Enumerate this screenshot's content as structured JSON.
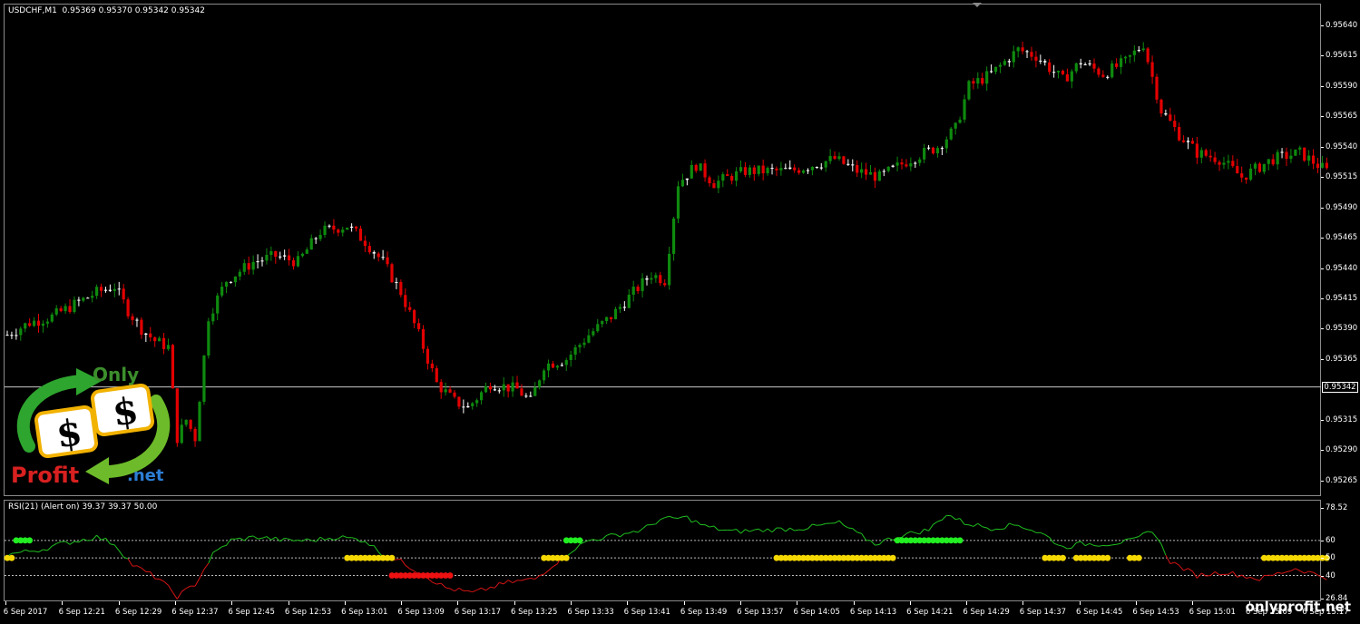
{
  "chart_data": [
    {
      "type": "candlestick",
      "title": "USDCHF,M1  0.95369 0.95370 0.95342 0.95342",
      "ylim": [
        0.95255,
        0.95652
      ],
      "y_ticks": [
        "0.95640",
        "0.95615",
        "0.95590",
        "0.95565",
        "0.95540",
        "0.95515",
        "0.95490",
        "0.95465",
        "0.95440",
        "0.95415",
        "0.95390",
        "0.95365",
        "0.95342",
        "0.95315",
        "0.95290",
        "0.95265"
      ],
      "current_price": "0.95342",
      "colors": {
        "up": "#0e8a0e",
        "down": "#e30000",
        "doji": "#ffffff",
        "hline": "#c8c8c8"
      },
      "close_path": [
        [
          0,
          0.95385
        ],
        [
          5,
          0.95395
        ],
        [
          10,
          0.954
        ],
        [
          15,
          0.9541
        ],
        [
          20,
          0.9542
        ],
        [
          24,
          0.95425
        ],
        [
          27,
          0.95405
        ],
        [
          30,
          0.9539
        ],
        [
          33,
          0.9538
        ],
        [
          36,
          0.95375
        ],
        [
          38,
          0.953
        ],
        [
          40,
          0.95315
        ],
        [
          42,
          0.953
        ],
        [
          45,
          0.954
        ],
        [
          49,
          0.9543
        ],
        [
          55,
          0.95445
        ],
        [
          60,
          0.9545
        ],
        [
          65,
          0.95445
        ],
        [
          70,
          0.9547
        ],
        [
          76,
          0.95475
        ],
        [
          80,
          0.95462
        ],
        [
          84,
          0.95445
        ],
        [
          88,
          0.9542
        ],
        [
          92,
          0.95385
        ],
        [
          96,
          0.95345
        ],
        [
          100,
          0.9533
        ],
        [
          103,
          0.95325
        ],
        [
          108,
          0.95345
        ],
        [
          114,
          0.9534
        ],
        [
          117,
          0.9533
        ],
        [
          120,
          0.9536
        ],
        [
          125,
          0.95365
        ],
        [
          130,
          0.95385
        ],
        [
          135,
          0.954
        ],
        [
          140,
          0.9542
        ],
        [
          144,
          0.95435
        ],
        [
          147,
          0.9543
        ],
        [
          150,
          0.9551
        ],
        [
          154,
          0.95525
        ],
        [
          158,
          0.9551
        ],
        [
          165,
          0.9552
        ],
        [
          175,
          0.9552
        ],
        [
          185,
          0.9553
        ],
        [
          190,
          0.9552
        ],
        [
          195,
          0.95515
        ],
        [
          202,
          0.9553
        ],
        [
          208,
          0.9554
        ],
        [
          212,
          0.95555
        ],
        [
          215,
          0.9559
        ],
        [
          220,
          0.956
        ],
        [
          226,
          0.9562
        ],
        [
          230,
          0.95615
        ],
        [
          236,
          0.95595
        ],
        [
          240,
          0.9561
        ],
        [
          245,
          0.956
        ],
        [
          250,
          0.9561
        ],
        [
          254,
          0.95625
        ],
        [
          258,
          0.9557
        ],
        [
          262,
          0.9555
        ],
        [
          266,
          0.95535
        ],
        [
          271,
          0.9553
        ],
        [
          276,
          0.95515
        ],
        [
          283,
          0.9553
        ],
        [
          289,
          0.95535
        ],
        [
          295,
          0.9552
        ]
      ],
      "x_labels": [
        "6 Sep 2017",
        "6 Sep 12:21",
        "6 Sep 12:29",
        "6 Sep 12:37",
        "6 Sep 12:45",
        "6 Sep 12:53",
        "6 Sep 13:01",
        "6 Sep 13:09",
        "6 Sep 13:17",
        "6 Sep 13:25",
        "6 Sep 13:33",
        "6 Sep 13:41",
        "6 Sep 13:49",
        "6 Sep 13:57",
        "6 Sep 14:05",
        "6 Sep 14:13",
        "6 Sep 14:21",
        "6 Sep 14:29",
        "6 Sep 14:37",
        "6 Sep 14:45",
        "6 Sep 14:53",
        "6 Sep 15:01",
        "6 Sep 15:09",
        "6 Sep 15:17"
      ]
    },
    {
      "type": "line",
      "title": "RSI(21) (Alert on) 39.37 39.37 50.00",
      "ylim": [
        26.84,
        78.52
      ],
      "y_ticks": [
        "78.52",
        "60",
        "50",
        "40",
        "26.84"
      ],
      "levels": [
        60,
        50,
        40
      ],
      "rsi_path": [
        [
          0,
          52
        ],
        [
          8,
          55
        ],
        [
          12,
          58
        ],
        [
          20,
          62
        ],
        [
          24,
          58
        ],
        [
          28,
          46
        ],
        [
          34,
          38
        ],
        [
          38,
          28
        ],
        [
          42,
          35
        ],
        [
          46,
          52
        ],
        [
          50,
          60
        ],
        [
          56,
          62
        ],
        [
          62,
          60
        ],
        [
          68,
          60
        ],
        [
          74,
          62
        ],
        [
          80,
          60
        ],
        [
          84,
          52
        ],
        [
          88,
          48
        ],
        [
          92,
          42
        ],
        [
          98,
          33
        ],
        [
          104,
          30
        ],
        [
          112,
          36
        ],
        [
          118,
          38
        ],
        [
          122,
          46
        ],
        [
          126,
          54
        ],
        [
          130,
          60
        ],
        [
          136,
          63
        ],
        [
          142,
          66
        ],
        [
          146,
          72
        ],
        [
          152,
          73
        ],
        [
          156,
          68
        ],
        [
          162,
          65
        ],
        [
          170,
          66
        ],
        [
          178,
          67
        ],
        [
          186,
          70
        ],
        [
          190,
          64
        ],
        [
          194,
          58
        ],
        [
          200,
          63
        ],
        [
          206,
          66
        ],
        [
          210,
          75
        ],
        [
          214,
          70
        ],
        [
          220,
          67
        ],
        [
          226,
          69
        ],
        [
          232,
          63
        ],
        [
          236,
          56
        ],
        [
          240,
          58
        ],
        [
          246,
          58
        ],
        [
          252,
          60
        ],
        [
          256,
          66
        ],
        [
          260,
          48
        ],
        [
          266,
          40
        ],
        [
          272,
          42
        ],
        [
          280,
          38
        ],
        [
          288,
          44
        ],
        [
          295,
          39
        ]
      ],
      "dot_groups": [
        {
          "color": "#22ee22",
          "level": 60,
          "from": 2,
          "to": 5
        },
        {
          "color": "#f5d800",
          "level": 50,
          "from": 0,
          "to": 1
        },
        {
          "color": "#f5d800",
          "level": 50,
          "from": 76,
          "to": 86
        },
        {
          "color": "#ee1111",
          "level": 40,
          "from": 86,
          "to": 99
        },
        {
          "color": "#f5d800",
          "level": 50,
          "from": 120,
          "to": 125
        },
        {
          "color": "#22ee22",
          "level": 60,
          "from": 125,
          "to": 128
        },
        {
          "color": "#f5d800",
          "level": 50,
          "from": 172,
          "to": 198
        },
        {
          "color": "#22ee22",
          "level": 60,
          "from": 199,
          "to": 213
        },
        {
          "color": "#f5d800",
          "level": 50,
          "from": 232,
          "to": 236
        },
        {
          "color": "#f5d800",
          "level": 50,
          "from": 239,
          "to": 246
        },
        {
          "color": "#f5d800",
          "level": 50,
          "from": 251,
          "to": 253
        },
        {
          "color": "#f5d800",
          "level": 50,
          "from": 281,
          "to": 295
        }
      ]
    }
  ],
  "logo": {
    "word1": "Only",
    "word2": "Profit",
    "word3": ".net",
    "symbol": "$"
  },
  "watermark": "onlyprofit.net"
}
